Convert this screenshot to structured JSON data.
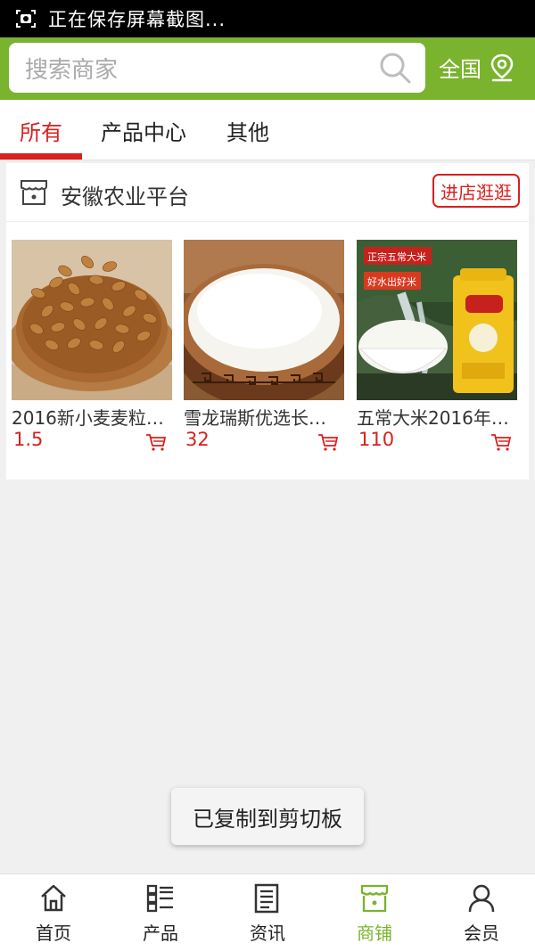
{
  "status_bar": {
    "text": "正在保存屏幕截图..."
  },
  "search": {
    "placeholder": "搜索商家"
  },
  "region": {
    "label": "全国"
  },
  "tabs": [
    {
      "label": "所有",
      "active": true
    },
    {
      "label": "产品中心",
      "active": false
    },
    {
      "label": "其他",
      "active": false
    }
  ],
  "shop": {
    "name": "安徽农业平台",
    "visit_button": "进店逛逛"
  },
  "products": [
    {
      "title": "2016新小麦麦粒…",
      "price": "1.5"
    },
    {
      "title": "雪龙瑞斯优选长…",
      "price": "32"
    },
    {
      "title": "五常大米2016年…",
      "price": "110",
      "image_text": [
        "正宗五常大米",
        "好水出好米"
      ]
    }
  ],
  "toast": {
    "text": "已复制到剪切板"
  },
  "bottom_nav": [
    {
      "label": "首页",
      "icon": "home-icon",
      "active": false
    },
    {
      "label": "产品",
      "icon": "grid-list-icon",
      "active": false
    },
    {
      "label": "资讯",
      "icon": "news-icon",
      "active": false
    },
    {
      "label": "商铺",
      "icon": "shop-icon",
      "active": true
    },
    {
      "label": "会员",
      "icon": "user-icon",
      "active": false
    }
  ],
  "colors": {
    "brand_green": "#7ab32e",
    "accent_red": "#d9201e"
  }
}
